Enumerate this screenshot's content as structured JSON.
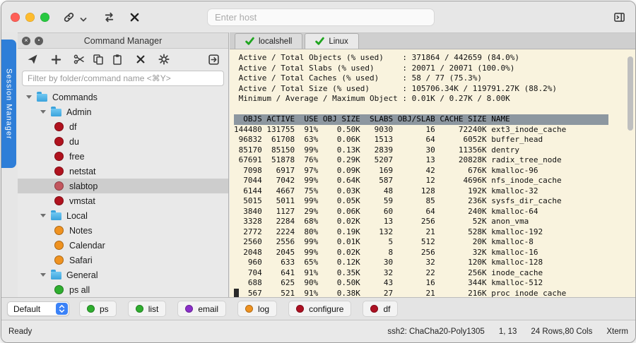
{
  "chrome": {
    "traffic_lights": [
      "#ff5f57",
      "#febc2e",
      "#28c840"
    ],
    "host_placeholder": "Enter host"
  },
  "session_tab": {
    "label": "Session Manager"
  },
  "command_manager": {
    "title": "Command Manager",
    "filter_placeholder": "Filter by folder/command name <⌘Y>",
    "tree": [
      {
        "label": "Commands",
        "type": "folder",
        "depth": 0,
        "expanded": true
      },
      {
        "label": "Admin",
        "type": "folder",
        "depth": 1,
        "expanded": true
      },
      {
        "label": "df",
        "type": "command",
        "depth": 2,
        "color": "#b0121e"
      },
      {
        "label": "du",
        "type": "command",
        "depth": 2,
        "color": "#b0121e"
      },
      {
        "label": "free",
        "type": "command",
        "depth": 2,
        "color": "#b0121e"
      },
      {
        "label": "netstat",
        "type": "command",
        "depth": 2,
        "color": "#b0121e"
      },
      {
        "label": "slabtop",
        "type": "command",
        "depth": 2,
        "color": "#c2565e",
        "selected": true
      },
      {
        "label": "vmstat",
        "type": "command",
        "depth": 2,
        "color": "#b0121e"
      },
      {
        "label": "Local",
        "type": "folder",
        "depth": 1,
        "expanded": true
      },
      {
        "label": "Notes",
        "type": "command",
        "depth": 2,
        "color": "#ef9220"
      },
      {
        "label": "Calendar",
        "type": "command",
        "depth": 2,
        "color": "#ef9220"
      },
      {
        "label": "Safari",
        "type": "command",
        "depth": 2,
        "color": "#ef9220"
      },
      {
        "label": "General",
        "type": "folder",
        "depth": 1,
        "expanded": true
      },
      {
        "label": "ps all",
        "type": "command",
        "depth": 2,
        "color": "#2fae2f"
      }
    ]
  },
  "tabs": [
    {
      "label": "localshell",
      "active": false
    },
    {
      "label": "Linux",
      "active": true
    }
  ],
  "terminal": {
    "summary": [
      {
        "label": "Active / Total Objects (% used)",
        "value": "371864 / 442659 (84.0%)"
      },
      {
        "label": "Active / Total Slabs (% used)",
        "value": "20071 / 20071 (100.0%)"
      },
      {
        "label": "Active / Total Caches (% used)",
        "value": "58 / 77 (75.3%)"
      },
      {
        "label": "Active / Total Size (% used)",
        "value": "105706.34K / 119791.27K (88.2%)"
      },
      {
        "label": "Minimum / Average / Maximum Object",
        "value": "0.01K / 0.27K / 8.00K"
      }
    ],
    "table": {
      "headers": [
        "OBJS",
        "ACTIVE",
        "USE",
        "OBJ SIZE",
        "SLABS",
        "OBJ/SLAB",
        "CACHE SIZE",
        "NAME"
      ],
      "rows": [
        [
          "144480",
          "131755",
          "91%",
          "0.50K",
          "9030",
          "16",
          "72240K",
          "ext3_inode_cache"
        ],
        [
          "96832",
          "61708",
          "63%",
          "0.06K",
          "1513",
          "64",
          "6052K",
          "buffer_head"
        ],
        [
          "85170",
          "85150",
          "99%",
          "0.13K",
          "2839",
          "30",
          "11356K",
          "dentry"
        ],
        [
          "67691",
          "51878",
          "76%",
          "0.29K",
          "5207",
          "13",
          "20828K",
          "radix_tree_node"
        ],
        [
          "7098",
          "6917",
          "97%",
          "0.09K",
          "169",
          "42",
          "676K",
          "kmalloc-96"
        ],
        [
          "7044",
          "7042",
          "99%",
          "0.64K",
          "587",
          "12",
          "4696K",
          "nfs_inode_cache"
        ],
        [
          "6144",
          "4667",
          "75%",
          "0.03K",
          "48",
          "128",
          "192K",
          "kmalloc-32"
        ],
        [
          "5015",
          "5011",
          "99%",
          "0.05K",
          "59",
          "85",
          "236K",
          "sysfs_dir_cache"
        ],
        [
          "3840",
          "1127",
          "29%",
          "0.06K",
          "60",
          "64",
          "240K",
          "kmalloc-64"
        ],
        [
          "3328",
          "2284",
          "68%",
          "0.02K",
          "13",
          "256",
          "52K",
          "anon_vma"
        ],
        [
          "2772",
          "2224",
          "80%",
          "0.19K",
          "132",
          "21",
          "528K",
          "kmalloc-192"
        ],
        [
          "2560",
          "2556",
          "99%",
          "0.01K",
          "5",
          "512",
          "20K",
          "kmalloc-8"
        ],
        [
          "2048",
          "2045",
          "99%",
          "0.02K",
          "8",
          "256",
          "32K",
          "kmalloc-16"
        ],
        [
          "960",
          "633",
          "65%",
          "0.12K",
          "30",
          "32",
          "120K",
          "kmalloc-128"
        ],
        [
          "704",
          "641",
          "91%",
          "0.35K",
          "32",
          "22",
          "256K",
          "inode_cache"
        ],
        [
          "688",
          "625",
          "90%",
          "0.50K",
          "43",
          "16",
          "344K",
          "kmalloc-512"
        ],
        [
          "567",
          "521",
          "91%",
          "0.38K",
          "27",
          "21",
          "216K",
          "proc_inode_cache"
        ]
      ]
    }
  },
  "button_bar": {
    "default_select": "Default",
    "buttons": [
      {
        "label": "ps",
        "color": "#2fae2f"
      },
      {
        "label": "list",
        "color": "#2fae2f"
      },
      {
        "label": "email",
        "color": "#8b2fc9"
      },
      {
        "label": "log",
        "color": "#ef9220"
      },
      {
        "label": "configure",
        "color": "#ad1022"
      },
      {
        "label": "df",
        "color": "#ad1022"
      }
    ]
  },
  "status_bar": {
    "left": "Ready",
    "encryption": "ssh2: ChaCha20-Poly1305",
    "cursor_pos": "1, 13",
    "size": "24 Rows,80 Cols",
    "term": "Xterm"
  }
}
